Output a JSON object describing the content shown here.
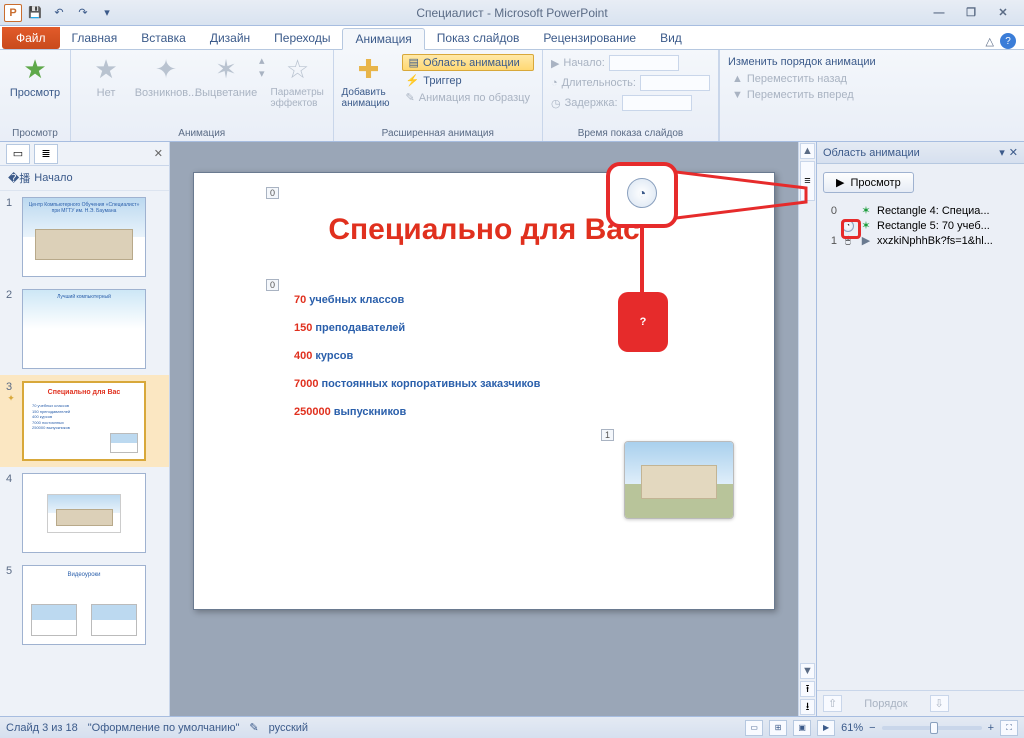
{
  "window": {
    "title": "Специалист - Microsoft PowerPoint"
  },
  "tabs": {
    "file": "Файл",
    "items": [
      "Главная",
      "Вставка",
      "Дизайн",
      "Переходы",
      "Анимация",
      "Показ слайдов",
      "Рецензирование",
      "Вид"
    ],
    "active_index": 4
  },
  "ribbon": {
    "preview": {
      "btn": "Просмотр",
      "group": "Просмотр"
    },
    "animation": {
      "none": "Нет",
      "appear": "Возникнов...",
      "fade": "Выцветание",
      "effect_opts": "Параметры эффектов",
      "group": "Анимация"
    },
    "advanced": {
      "add": "Добавить анимацию",
      "pane": "Область анимации",
      "trigger": "Триггер",
      "painter": "Анимация по образцу",
      "group": "Расширенная анимация"
    },
    "timing": {
      "start": "Начало:",
      "duration": "Длительность:",
      "delay": "Задержка:",
      "group": "Время показа слайдов"
    },
    "reorder": {
      "title": "Изменить порядок анимации",
      "back": "Переместить назад",
      "fwd": "Переместить вперед"
    }
  },
  "section_header": "Начало",
  "thumbnails": [
    {
      "num": "1",
      "caption": "Центр Компьютерного Обучения «Специалист» при МГТУ им. Н.Э. Баумана"
    },
    {
      "num": "2",
      "caption": "Лучший компьютерный"
    },
    {
      "num": "3",
      "caption": "Специально для Вас",
      "selected": true
    },
    {
      "num": "4",
      "caption": ""
    },
    {
      "num": "5",
      "caption": "Видеоуроки"
    }
  ],
  "slide": {
    "title": "Специально для Вас",
    "lines": [
      {
        "num": "70",
        "text": " учебных классов"
      },
      {
        "num": "150",
        "text": " преподавателей"
      },
      {
        "num": "400",
        "text": " курсов"
      },
      {
        "num": "7000",
        "text": " постоянных корпоративных заказчиков"
      },
      {
        "num": "250000",
        "text": " выпускников"
      }
    ],
    "tags": {
      "t0a": "0",
      "t0b": "0",
      "t1": "1"
    }
  },
  "callout": {
    "q": "?"
  },
  "anim_pane": {
    "title": "Область анимации",
    "play": "Просмотр",
    "rows": [
      {
        "seq": "0",
        "clock": false,
        "label": "Rectangle 4: Специа..."
      },
      {
        "seq": "",
        "clock": true,
        "label": "Rectangle 5: 70 учеб..."
      },
      {
        "seq": "1",
        "clock": true,
        "label": "xxzkiNphhBk?fs=1&hl...",
        "media": true
      }
    ],
    "order": "Порядок"
  },
  "status": {
    "slide": "Слайд 3 из 18",
    "theme": "\"Оформление по умолчанию\"",
    "lang": "русский",
    "zoom": "61%"
  }
}
